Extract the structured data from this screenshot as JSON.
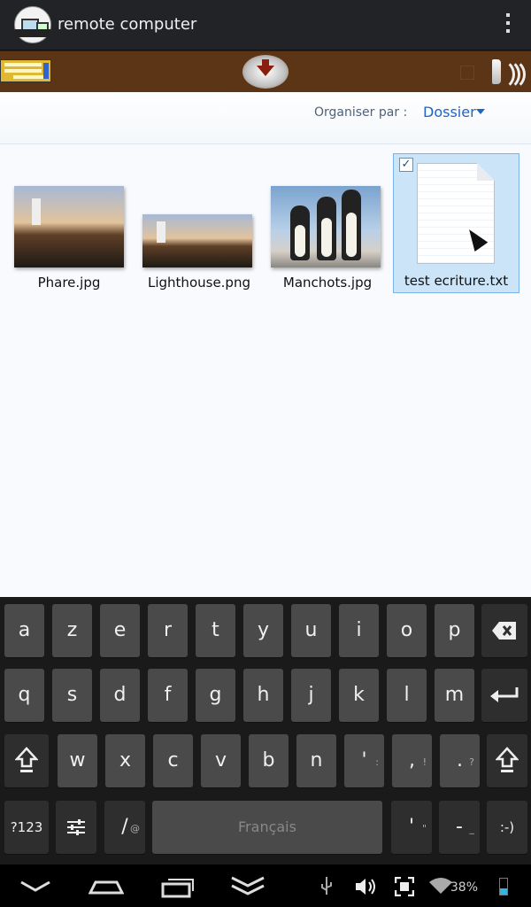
{
  "app_title": "remote computer",
  "explorer": {
    "organize_label": "Organiser par :",
    "organize_value": "Dossier",
    "files": [
      {
        "name": "Phare.jpg"
      },
      {
        "name": "Lighthouse.png"
      },
      {
        "name": "Manchots.jpg"
      },
      {
        "name": "test ecriture.txt",
        "selected": true,
        "checked": "✓"
      }
    ]
  },
  "keyboard": {
    "row1": [
      "a",
      "z",
      "e",
      "r",
      "t",
      "y",
      "u",
      "i",
      "o",
      "p"
    ],
    "row2": [
      "q",
      "s",
      "d",
      "f",
      "g",
      "h",
      "j",
      "k",
      "l",
      "m"
    ],
    "row3": [
      "w",
      "x",
      "c",
      "v",
      "b",
      "n",
      "'",
      ",",
      "."
    ],
    "row3_hints": [
      "",
      "",
      "",
      "",
      "",
      "",
      ":",
      "!",
      "?"
    ],
    "space_label": "Français",
    "sym_label": "?123",
    "slash_label": "/",
    "slash_hint": "@",
    "apostrophe_label": "'",
    "apostrophe_hint": "\"",
    "dash_label": "-",
    "dash_hint": "_",
    "smiley_label": ":-)",
    "backspace_icon": "backspace-icon",
    "enter_icon": "enter-icon",
    "shift_icon": "shift-icon"
  },
  "status_bar": {
    "battery": "38%"
  },
  "colors": {
    "toolbar": "#5c3416",
    "accent": "#1e64c4",
    "selection": "#cce4f7"
  }
}
